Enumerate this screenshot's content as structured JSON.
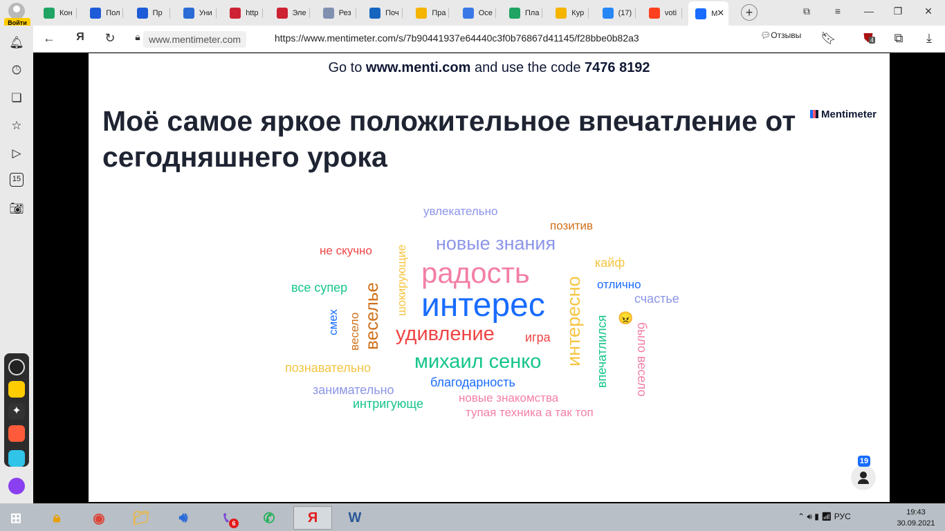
{
  "browser": {
    "login_label": "Войти",
    "tabs": [
      {
        "title": "Кон",
        "icon": "green-sheet-icon",
        "color": "#1fa463"
      },
      {
        "title": "Пол",
        "icon": "mail-icon",
        "color": "#1e5bd8"
      },
      {
        "title": "Пр",
        "icon": "mail-icon",
        "color": "#1e5bd8"
      },
      {
        "title": "Уни",
        "icon": "wave-icon",
        "color": "#2a6bd6"
      },
      {
        "title": "http",
        "icon": "red-tag-icon",
        "color": "#cc2233"
      },
      {
        "title": "Эле",
        "icon": "red-tag-icon",
        "color": "#cc2233"
      },
      {
        "title": "Рез",
        "icon": "shield-icon",
        "color": "#8090b0"
      },
      {
        "title": "Поч",
        "icon": "outlook-icon",
        "color": "#1565c0"
      },
      {
        "title": "Пра",
        "icon": "drive-icon",
        "color": "#f4b400"
      },
      {
        "title": "Осе",
        "icon": "doc-icon",
        "color": "#3b78e7"
      },
      {
        "title": "Пла",
        "icon": "green-sheet-icon",
        "color": "#1fa463"
      },
      {
        "title": "Кур",
        "icon": "drive-icon",
        "color": "#f4b400"
      },
      {
        "title": "(17)",
        "icon": "vk-icon",
        "color": "#2787f5"
      },
      {
        "title": "voti",
        "icon": "yandex-icon",
        "color": "#fc3f1d"
      },
      {
        "title": "M",
        "icon": "mentimeter-icon",
        "color": "#196cff",
        "active": true
      }
    ],
    "domain": "www.mentimeter.com",
    "url": "https://www.mentimeter.com/s/7b90441937e64440c3f0b76867d41145/f28bbe0b82a3",
    "reviews_label": "Отзывы",
    "extension_badge": "4",
    "sidebar_badge": "15"
  },
  "slide": {
    "goto_prefix": "Go to ",
    "goto_site": "www.menti.com",
    "goto_middle": " and use the code ",
    "goto_code": "7476 8192",
    "question": "Моё самое яркое положительное впечатление от сегодняшнего урока",
    "brand": "Mentimeter",
    "participants": "19",
    "words": [
      {
        "text": "увлекательно",
        "color": "#8c95e8"
      },
      {
        "text": "позитив",
        "color": "#d0701a"
      },
      {
        "text": "новые знания",
        "color": "#8c95e8"
      },
      {
        "text": "не скучно",
        "color": "#ef4444"
      },
      {
        "text": "шокирующие",
        "color": "#f5c542"
      },
      {
        "text": "радость",
        "color": "#f37ea6"
      },
      {
        "text": "кайф",
        "color": "#f5c542"
      },
      {
        "text": "интересно",
        "color": "#f5c542"
      },
      {
        "text": "все супер",
        "color": "#14c58a"
      },
      {
        "text": "отлично",
        "color": "#196cff"
      },
      {
        "text": "интерес",
        "color": "#196cff"
      },
      {
        "text": "счастье",
        "color": "#8c95e8"
      },
      {
        "text": "веселье",
        "color": "#d0701a"
      },
      {
        "text": "смех",
        "color": "#196cff"
      },
      {
        "text": "весело",
        "color": "#d0701a"
      },
      {
        "text": "удивление",
        "color": "#ef4444"
      },
      {
        "text": "игра",
        "color": "#ef4444"
      },
      {
        "text": "впечатлился",
        "color": "#14c58a"
      },
      {
        "text": "было весело",
        "color": "#f37ea6"
      },
      {
        "text": "познавательно",
        "color": "#f5c542"
      },
      {
        "text": "михаил сенко",
        "color": "#14c58a"
      },
      {
        "text": "благодарность",
        "color": "#196cff"
      },
      {
        "text": "занимательно",
        "color": "#8c95e8"
      },
      {
        "text": "новые знакомства",
        "color": "#f37ea6"
      },
      {
        "text": "интригующе",
        "color": "#14c58a"
      },
      {
        "text": "тупая техника а так топ",
        "color": "#f37ea6"
      },
      {
        "text": "😠",
        "color": "#f5b700"
      }
    ]
  },
  "taskbar": {
    "items": [
      {
        "name": "windows-start-icon"
      },
      {
        "name": "yandex-browser-lock-icon"
      },
      {
        "name": "chrome-icon"
      },
      {
        "name": "file-explorer-icon"
      },
      {
        "name": "volume-app-icon"
      },
      {
        "name": "viber-icon",
        "badge": "6"
      },
      {
        "name": "whatsapp-icon"
      },
      {
        "name": "yandex-icon"
      },
      {
        "name": "word-icon"
      }
    ],
    "lang": "РУС",
    "time": "19:43",
    "date": "30.09.2021"
  }
}
